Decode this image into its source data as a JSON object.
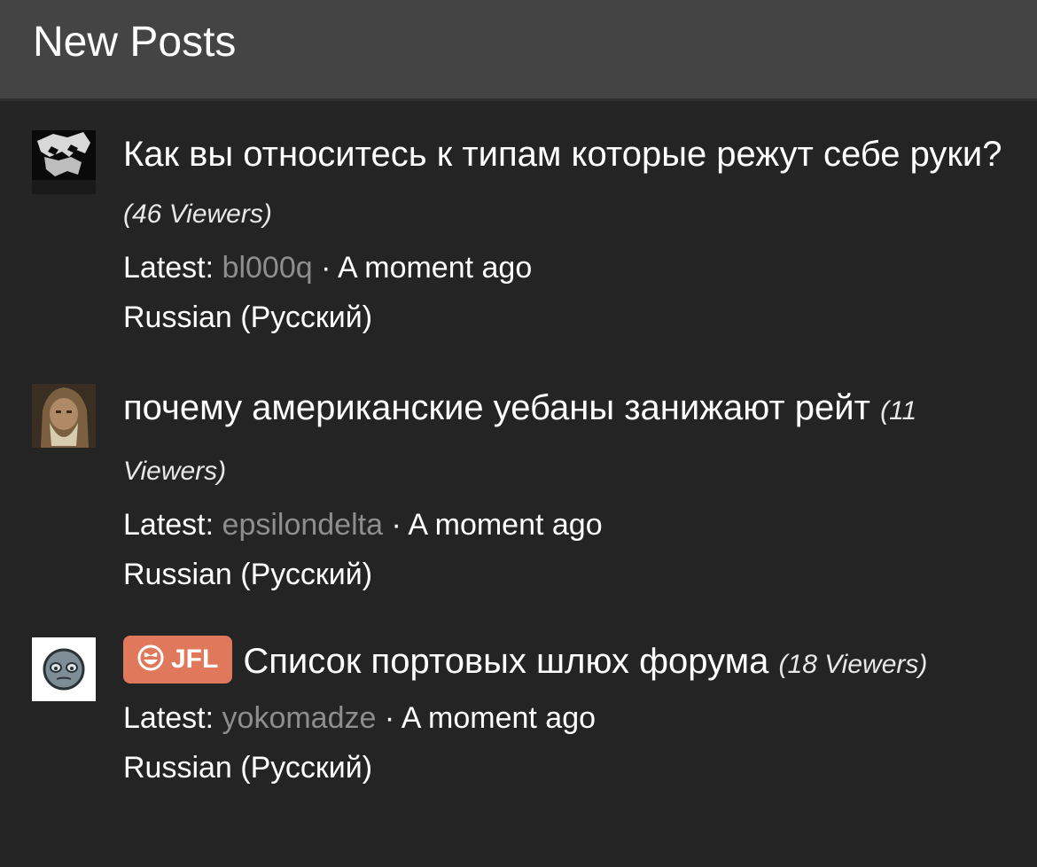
{
  "header": {
    "title": "New Posts"
  },
  "posts": [
    {
      "title": "Как вы относитесь к типам которые режут себе руки?",
      "viewers": "(46 Viewers)",
      "latest_label": "Latest:",
      "user": "bl000q",
      "separator": "·",
      "time": "A moment ago",
      "language": "Russian (Русский)"
    },
    {
      "title": "почему американские уебаны занижают рейт",
      "viewers": "(11 Viewers)",
      "latest_label": "Latest:",
      "user": "epsilondelta",
      "separator": "·",
      "time": "A moment ago",
      "language": "Russian (Русский)"
    },
    {
      "badge": "JFL",
      "title": "Список портовых шлюх форума",
      "viewers": "(18 Viewers)",
      "latest_label": "Latest:",
      "user": "yokomadze",
      "separator": "·",
      "time": "A moment ago",
      "language": "Russian (Русский)"
    }
  ],
  "colors": {
    "background": "#242424",
    "header": "#444444",
    "username": "#8e8e8e",
    "badge": "#e0785c"
  }
}
